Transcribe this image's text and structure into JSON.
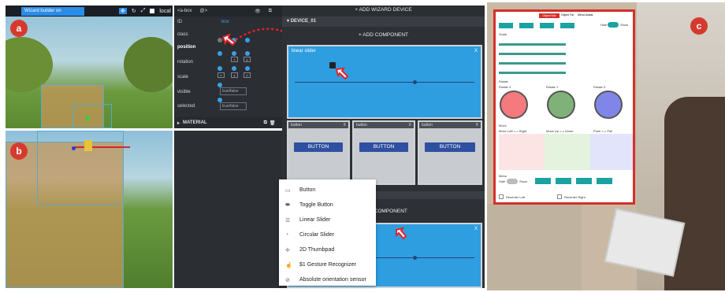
{
  "panel_a": {
    "badge": "a",
    "toolbar": {
      "title": "Wizard builder on",
      "local_label": "local"
    }
  },
  "panel_b": {
    "badge": "b"
  },
  "panel_c": {
    "badge": "c"
  },
  "inspector": {
    "entity": "<a-box",
    "entity_suffix": "@>",
    "rows": {
      "id": "ID",
      "id_value": "box",
      "class": "class",
      "position": "position",
      "rotation": "rotation",
      "scale": "scale",
      "visible": "visible",
      "selected": "selected"
    },
    "visible_value": "true/false",
    "selected_value": "true/false",
    "material": "MATERIAL",
    "axis": [
      "x",
      "y",
      "z"
    ]
  },
  "wizard": {
    "add_device": "+ ADD WIZARD DEVICE",
    "device": "DEVICE_01",
    "add_component": "+ ADD COMPONENT",
    "add_component_2": "ADD COMPONENT",
    "linear_slider_title": "linear slider",
    "close": "X",
    "button_card_label": "button",
    "button_label": "BUTTON"
  },
  "component_menu": {
    "items": [
      {
        "label": "Button",
        "icon": "button-icon"
      },
      {
        "label": "Toggle Button",
        "icon": "toggle-icon"
      },
      {
        "label": "Linear Slider",
        "icon": "linear-slider-icon"
      },
      {
        "label": "Circular Slider",
        "icon": "circular-slider-icon"
      },
      {
        "label": "2D Thumbpad",
        "icon": "thumbpad-icon"
      },
      {
        "label": "$1 Gesture Recognizer",
        "icon": "gesture-icon"
      },
      {
        "label": "Absolute orientation sensor",
        "icon": "orientation-icon"
      }
    ]
  },
  "tablet": {
    "tabs": [
      "Object Nav",
      "Object Far",
      "Menu Avatar"
    ],
    "hide": "Hide",
    "show": "Show",
    "scale": "Scale",
    "rotate": "Rotate",
    "rotate_labels": [
      "Rotate X",
      "Rotate Y",
      "Rotate Z"
    ],
    "move": "Move",
    "move_labels": [
      "Move Left <-> Right",
      "Move Up <-> Down",
      "Push <-> Pull"
    ],
    "menu": "Menu",
    "recenter_left": "Recenter Left",
    "recenter_right": "Recenter Right",
    "colors": {
      "accent": "#d4302a",
      "teal": "#1aa3a0"
    }
  }
}
